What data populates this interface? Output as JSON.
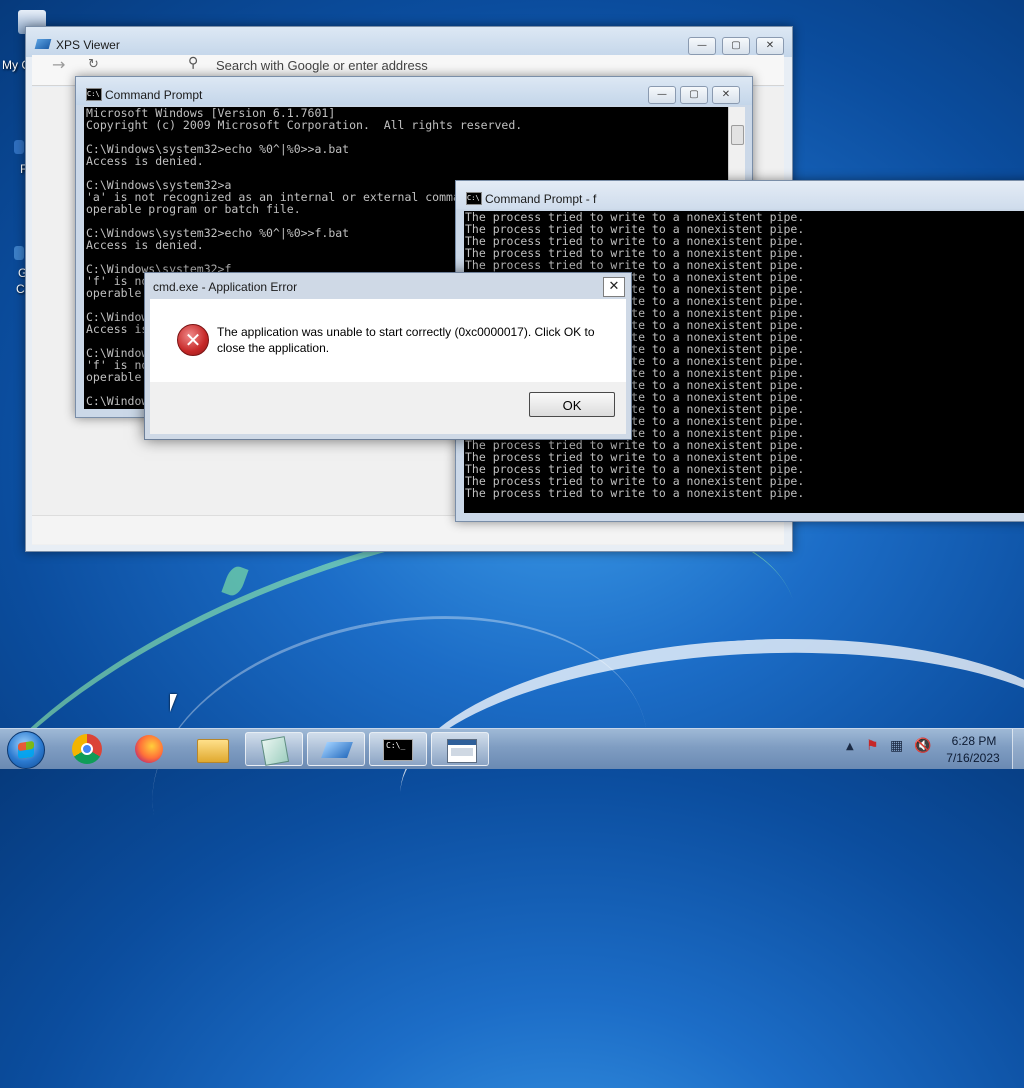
{
  "desktop_icons": [
    {
      "label": "My C",
      "top": 0
    },
    {
      "label": "F",
      "top": 0
    },
    {
      "label": "G",
      "top": 0
    },
    {
      "label": "C",
      "top": 0
    }
  ],
  "xps_viewer": {
    "title": "XPS Viewer",
    "address_placeholder": "Search with Google or enter address"
  },
  "cmd_main": {
    "title": "Command Prompt",
    "lines": [
      "Microsoft Windows [Version 6.1.7601]",
      "Copyright (c) 2009 Microsoft Corporation.  All rights reserved.",
      "",
      "C:\\Windows\\system32>echo %0^|%0>>a.bat",
      "Access is denied.",
      "",
      "C:\\Windows\\system32>a",
      "'a' is not recognized as an internal or external command,",
      "operable program or batch file.",
      "",
      "C:\\Windows\\system32>echo %0^|%0>>f.bat",
      "Access is denied.",
      "",
      "C:\\Windows\\system32>f",
      "'f' is not recognized as an internal or external command,",
      "operable program or batch file.",
      "",
      "C:\\Windows\\system32>echo %0^|%0>>f.bat",
      "Access is denied.",
      "",
      "C:\\Windows\\system32>f",
      "'f' is not recognized as an internal or external command,",
      "operable program or batch file.",
      "",
      "C:\\Windows\\system32>"
    ]
  },
  "cmd_f": {
    "title": "Command Prompt - f",
    "line": "The process tried to write to a nonexistent pipe.",
    "repeat": 24
  },
  "dialog": {
    "title": "cmd.exe - Application Error",
    "message_line1": "The application was unable to start correctly (0xc0000017). Click OK to",
    "message_line2": "close the application.",
    "ok_label": "OK"
  },
  "taskbar": {
    "time": "6:28 PM",
    "date": "7/16/2023",
    "cmd_glyph": "C:\\_"
  },
  "colors": {
    "error_red": "#c62828",
    "console_text": "#c0c0c0"
  }
}
